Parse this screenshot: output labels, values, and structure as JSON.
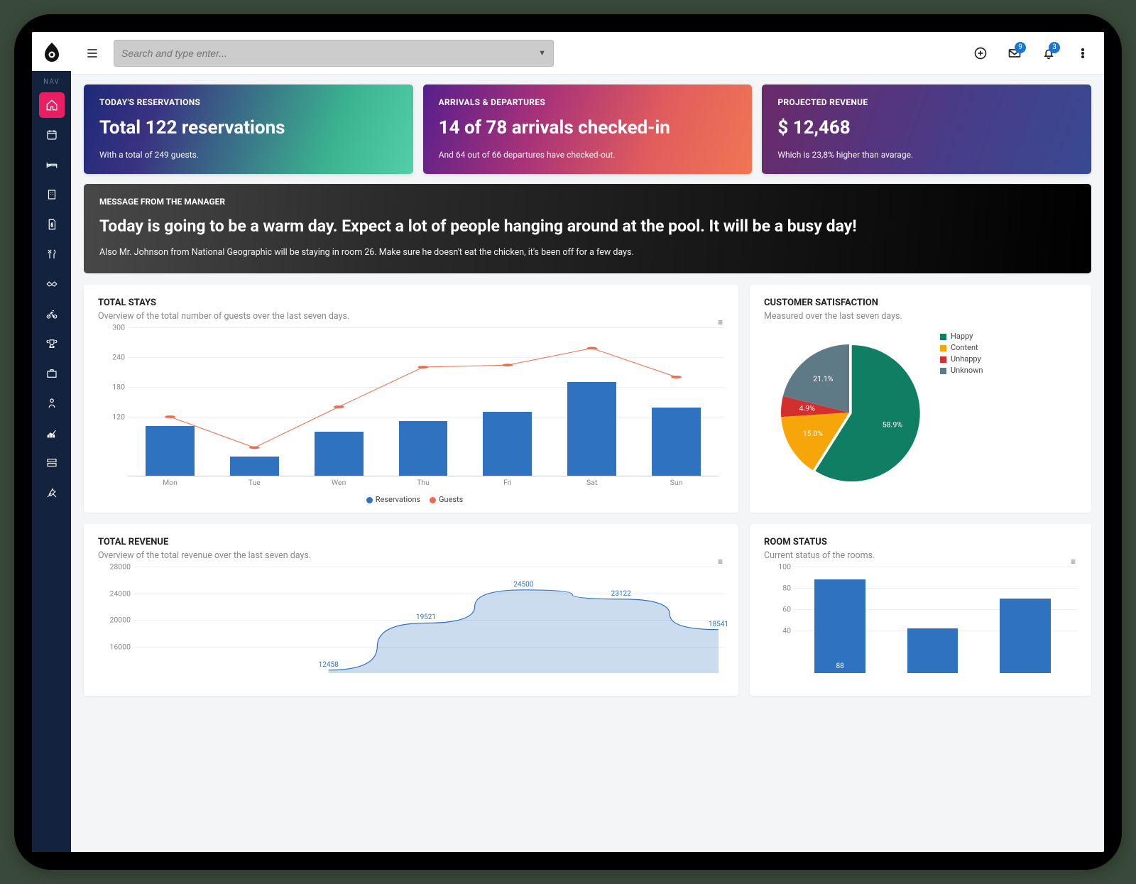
{
  "sidebar": {
    "section": "NAV",
    "items": [
      {
        "name": "home",
        "active": true
      },
      {
        "name": "calendar"
      },
      {
        "name": "bed"
      },
      {
        "name": "building"
      },
      {
        "name": "invoice"
      },
      {
        "name": "restaurant"
      },
      {
        "name": "handshake"
      },
      {
        "name": "bike"
      },
      {
        "name": "trophy"
      },
      {
        "name": "briefcase"
      },
      {
        "name": "person-wait"
      },
      {
        "name": "analytics"
      },
      {
        "name": "servers"
      },
      {
        "name": "tools"
      }
    ]
  },
  "topbar": {
    "search_placeholder": "Search and type enter...",
    "mail_badge": "9",
    "bell_badge": "3"
  },
  "cards": {
    "c1": {
      "label": "TODAY'S RESERVATIONS",
      "value": "Total 122 reservations",
      "sub": "With a total of 249 guests."
    },
    "c2": {
      "label": "ARRIVALS & DEPARTURES",
      "value": "14 of 78 arrivals checked-in",
      "sub": "And 64 out of 66 departures have checked-out."
    },
    "c3": {
      "label": "PROJECTED REVENUE",
      "value": "$ 12,468",
      "sub": "Which is 23,8% higher than avarage."
    }
  },
  "message": {
    "label": "MESSAGE FROM THE MANAGER",
    "value": "Today is going to be a warm day. Expect a lot of people hanging around at the pool. It will be a busy day!",
    "sub": "Also Mr. Johnson from National Geographic will be staying in room 26. Make sure he doesn't eat the chicken, it's been off for a few days."
  },
  "stays": {
    "title": "TOTAL STAYS",
    "sub": "Overview of the total number of guests over the last seven days.",
    "legend_res": "Reservations",
    "legend_gue": "Guests"
  },
  "satisfaction": {
    "title": "CUSTOMER SATISFACTION",
    "sub": "Measured over the last seven days."
  },
  "revenue": {
    "title": "TOTAL REVENUE",
    "sub": "Overview of the total revenue over the last seven days."
  },
  "rooms": {
    "title": "ROOM STATUS",
    "sub": "Current status of the rooms."
  },
  "chart_data": [
    {
      "id": "total_stays",
      "type": "bar+line",
      "categories": [
        "Mon",
        "Tue",
        "Wen",
        "Thu",
        "Fri",
        "Sat",
        "Sun"
      ],
      "series": [
        {
          "name": "Reservations",
          "values": [
            102,
            40,
            90,
            112,
            130,
            190,
            138
          ],
          "color": "#2f72bf"
        },
        {
          "name": "Guests",
          "values": [
            120,
            58,
            140,
            220,
            224,
            258,
            200
          ],
          "color": "#f26a4b"
        }
      ],
      "ylim": [
        0,
        300
      ],
      "yticks": [
        120,
        180,
        240,
        300
      ]
    },
    {
      "id": "customer_satisfaction",
      "type": "pie",
      "series": [
        {
          "name": "Happy",
          "value": 58.9,
          "color": "#0f7e63"
        },
        {
          "name": "Content",
          "value": 15.0,
          "color": "#f6a609"
        },
        {
          "name": "Unhappy",
          "value": 4.9,
          "color": "#d32f2f"
        },
        {
          "name": "Unknown",
          "value": 21.1,
          "color": "#5e7a86"
        }
      ],
      "labels": [
        "58.9%",
        "15.0%",
        "4.9%",
        "21.1%"
      ]
    },
    {
      "id": "total_revenue",
      "type": "area",
      "x": [
        0,
        1,
        2,
        3,
        4,
        5,
        6
      ],
      "values": [
        null,
        null,
        12458,
        19521,
        24500,
        23122,
        18541
      ],
      "ylim": [
        12000,
        28000
      ],
      "yticks": [
        16000,
        20000,
        24000,
        28000
      ]
    },
    {
      "id": "room_status",
      "type": "bar",
      "categories": [
        "",
        "",
        ""
      ],
      "values": [
        88,
        42,
        70
      ],
      "labels": [
        "88",
        "",
        ""
      ],
      "ylim": [
        0,
        100
      ],
      "yticks": [
        40,
        60,
        80,
        100
      ]
    }
  ]
}
